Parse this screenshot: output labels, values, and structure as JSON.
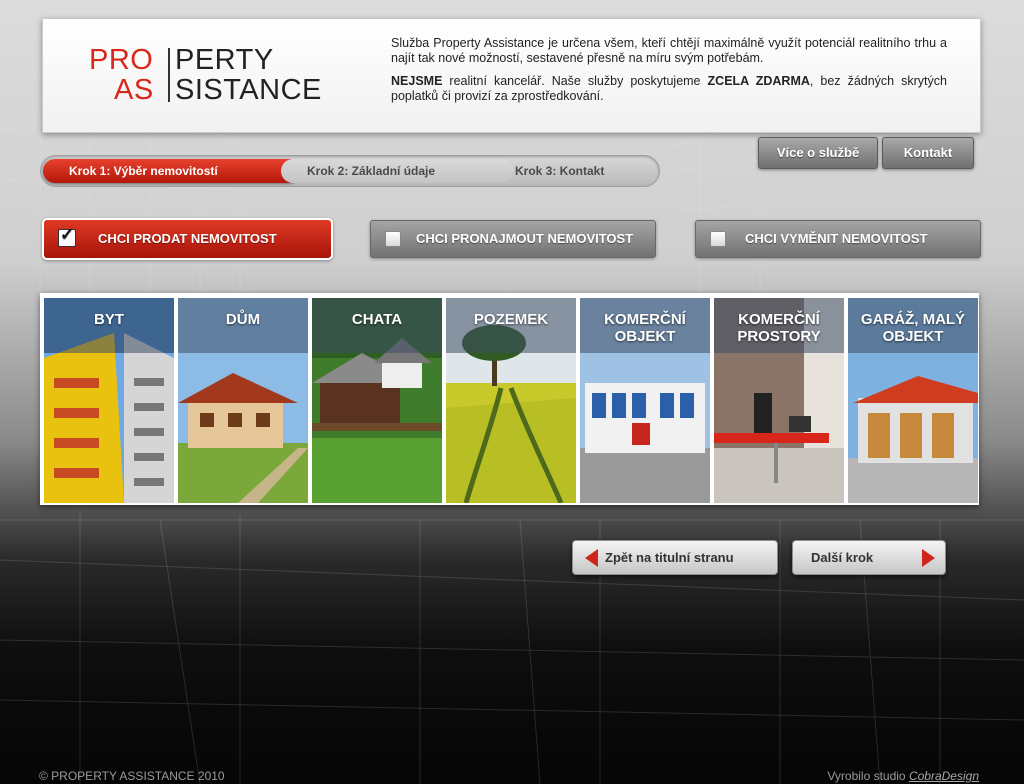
{
  "logo": {
    "pro": "PRO",
    "perty": "PERTY",
    "as": "AS",
    "sistance": "SISTANCE"
  },
  "intro": {
    "p1": "Služba Property Assistance je určena všem, kteří chtějí maximálně využít potenciál realitního trhu a najít tak nové možností, sestavené přesně na míru svým potřebám.",
    "p2_bold1": "NEJSME",
    "p2_text1": " realitní kancelář. Naše služby poskytujeme ",
    "p2_bold2": "ZCELA ZDARMA",
    "p2_text2": ", bez žádných skrytých poplatků či provizí za zprostředkování."
  },
  "header_buttons": {
    "more": "Více o službě",
    "contact": "Kontakt"
  },
  "steps": [
    "Krok 1: Výběr nemovitostí",
    "Krok 2: Základní údaje",
    "Krok 3: Kontakt"
  ],
  "options": [
    {
      "label": "CHCI PRODAT NEMOVITOST",
      "checked": true
    },
    {
      "label": "CHCI PRONAJMOUT NEMOVITOST",
      "checked": false
    },
    {
      "label": "CHCI VYMĚNIT NEMOVITOST",
      "checked": false
    }
  ],
  "check_mark": "✓",
  "tiles": [
    {
      "label": "BYT"
    },
    {
      "label": "DŮM"
    },
    {
      "label": "CHATA"
    },
    {
      "label": "POZEMEK"
    },
    {
      "label": "KOMERČNÍ OBJEKT"
    },
    {
      "label": "KOMERČNÍ PROSTORY"
    },
    {
      "label": "GARÁŽ, MALÝ OBJEKT"
    }
  ],
  "nav": {
    "back": "Zpět na titulní stranu",
    "next": "Další krok"
  },
  "footer": {
    "copyright": "© PROPERTY ASSISTANCE 2010",
    "made_by": "Vyrobilo studio ",
    "studio": "CobraDesign"
  },
  "colors": {
    "accent": "#d9281a",
    "tile_caption": "#3e4e64"
  }
}
